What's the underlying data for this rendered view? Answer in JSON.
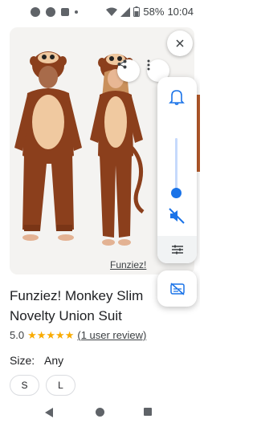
{
  "status_bar": {
    "left_icons": [
      "messenger-icon",
      "messenger-icon",
      "square-app-icon",
      "dot-icon"
    ],
    "battery_percent": "58%",
    "time": "10:04"
  },
  "product": {
    "image_icons": {
      "share": "share-icon",
      "more": "more-vert-icon"
    },
    "source_label": "Funziez!",
    "title_line1": "Funziez! Monkey Slim",
    "title_line2": "Novelty Union Suit",
    "rating_value": "5.0",
    "rating_stars": 5,
    "reviews_text": "(1 user review)",
    "size_label": "Size:",
    "size_value": "Any",
    "sizes": [
      "S",
      "L"
    ]
  },
  "volume_panel": {
    "icons": [
      "close-icon",
      "bell-icon",
      "mute-icon",
      "sliders-icon",
      "captions-off-icon"
    ],
    "level": 0.05,
    "accent_color": "#1a73e8"
  },
  "colors": {
    "star": "#f9ab00",
    "costume_brown": "#8b3f1c",
    "costume_belly": "#f0c9a0"
  }
}
